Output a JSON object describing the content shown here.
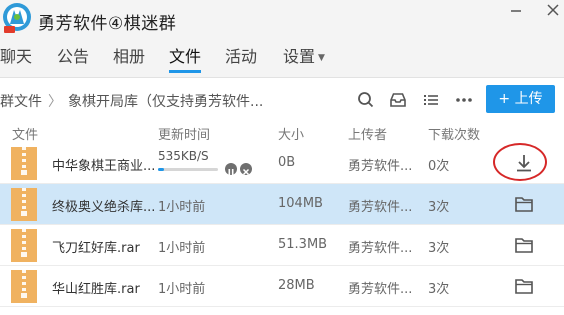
{
  "window": {
    "title": "勇芳软件④棋迷群",
    "logo_icon": "qq-group-logo-icon",
    "controls": [
      "minimize-icon",
      "maximize-icon",
      "close-icon"
    ]
  },
  "tabs": [
    {
      "label": "聊天",
      "active": false
    },
    {
      "label": "公告",
      "active": false
    },
    {
      "label": "相册",
      "active": false
    },
    {
      "label": "文件",
      "active": true
    },
    {
      "label": "活动",
      "active": false
    },
    {
      "label": "设置",
      "active": false,
      "has_dropdown": true
    }
  ],
  "breadcrumb": {
    "root": "群文件",
    "separator": "〉",
    "current": "象棋开局库（仅支持勇芳软件..."
  },
  "toolbar": {
    "icons": [
      "search-icon",
      "inbox-icon",
      "list-view-icon",
      "more-icon"
    ],
    "upload_label": "+ 上传",
    "accent": "#1f96e8"
  },
  "columns": [
    "文件",
    "更新时间",
    "大小",
    "上传者",
    "下载次数"
  ],
  "files": [
    {
      "name": "中华象棋王商业...",
      "time": "535KB/S",
      "progress": 0.1,
      "size": "0B",
      "uploader": "勇芳软件...",
      "downloads": "0次",
      "action_icon": "download-icon",
      "downloading": true
    },
    {
      "name": "终极奥义绝杀库...",
      "time": "1小时前",
      "size": "104MB",
      "uploader": "勇芳软件...",
      "downloads": "3次",
      "action_icon": "folder-icon",
      "selected": true
    },
    {
      "name": "飞刀红好库.rar",
      "time": "1小时前",
      "size": "51.3MB",
      "uploader": "勇芳软件...",
      "downloads": "3次",
      "action_icon": "folder-icon"
    },
    {
      "name": "华山红胜库.rar",
      "time": "1小时前",
      "size": "28MB",
      "uploader": "勇芳软件...",
      "downloads": "3次",
      "action_icon": "folder-icon"
    }
  ],
  "colors": {
    "archive_icon": "#f0b260",
    "selected_row": "#cfe6f8",
    "highlight_circle": "#d62828"
  }
}
